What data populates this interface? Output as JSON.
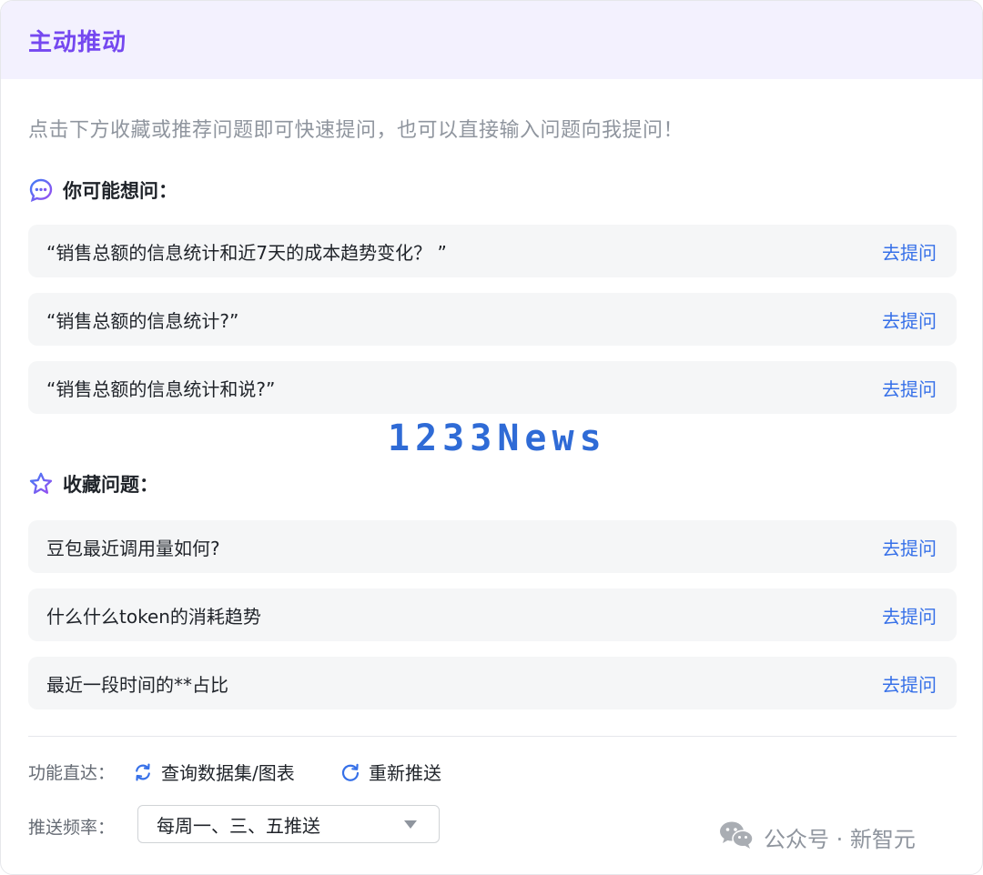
{
  "header": {
    "title": "主动推动"
  },
  "intro": "点击下方收藏或推荐问题即可快速提问，也可以直接输入问题向我提问！",
  "suggest": {
    "title": "你可能想问：",
    "items": [
      {
        "text": "“销售总额的信息统计和近7天的成本趋势变化？ ”",
        "action": "去提问"
      },
      {
        "text": "“销售总额的信息统计?”",
        "action": "去提问"
      },
      {
        "text": "“销售总额的信息统计和说?”",
        "action": "去提问"
      }
    ]
  },
  "brand_watermark": "1233News",
  "favorites": {
    "title": "收藏问题：",
    "items": [
      {
        "text": "豆包最近调用量如何?",
        "action": "去提问"
      },
      {
        "text": "什么什么token的消耗趋势",
        "action": "去提问"
      },
      {
        "text": "最近一段时间的**占比",
        "action": "去提问"
      }
    ]
  },
  "footer": {
    "direct_label": "功能直达：",
    "query_link": "查询数据集/图表",
    "repush_link": "重新推送",
    "freq_label": "推送频率：",
    "freq_value": "每周一、三、五推送"
  },
  "source_watermark": "公众号 · 新智元",
  "colors": {
    "accent": "#7548f0",
    "link": "#3670e8",
    "header_bg": "#f3f1fe",
    "row_bg": "#f5f6f7"
  }
}
